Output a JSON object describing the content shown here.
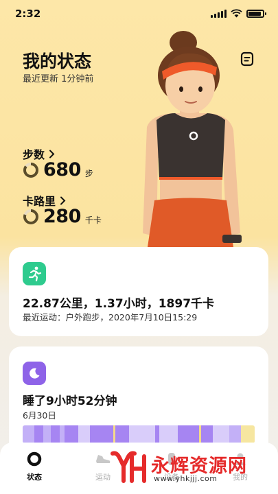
{
  "status_bar": {
    "time": "2:32",
    "battery_level": 0.9
  },
  "header": {
    "title": "我的状态",
    "subtitle": "最近更新 1分钟前",
    "doc_icon": "document-icon"
  },
  "stats": {
    "steps": {
      "label": "步数",
      "value": "680",
      "unit": "步",
      "ring_progress": 0.85
    },
    "calories": {
      "label": "卡路里",
      "value": "280",
      "unit": "千卡",
      "ring_progress": 0.8
    }
  },
  "run_card": {
    "icon": "running-icon",
    "headline": "22.87公里，1.37小时，1897千卡",
    "detail": "最近运动：户外跑步，2020年7月10日15:29",
    "accent": "#2ecb8e"
  },
  "sleep_card": {
    "icon": "moon-icon",
    "headline": "睡了9小时52分钟",
    "date": "6月30日",
    "accent": "#8e63e8",
    "segments": [
      {
        "w": 5,
        "c": "#c3b0f7"
      },
      {
        "w": 4,
        "c": "#a685f2"
      },
      {
        "w": 3,
        "c": "#c3b0f7"
      },
      {
        "w": 4,
        "c": "#a685f2"
      },
      {
        "w": 2,
        "c": "#c3b0f7"
      },
      {
        "w": 6,
        "c": "#a685f2"
      },
      {
        "w": 5,
        "c": "#d9cdfa"
      },
      {
        "w": 10,
        "c": "#a685f2"
      },
      {
        "w": 1,
        "c": "#f3d98a"
      },
      {
        "w": 6,
        "c": "#a685f2"
      },
      {
        "w": 11,
        "c": "#d9cdfa"
      },
      {
        "w": 2,
        "c": "#a685f2"
      },
      {
        "w": 8,
        "c": "#d9cdfa"
      },
      {
        "w": 9,
        "c": "#a685f2"
      },
      {
        "w": 1,
        "c": "#f3d98a"
      },
      {
        "w": 5,
        "c": "#a685f2"
      },
      {
        "w": 7,
        "c": "#d9cdfa"
      },
      {
        "w": 5,
        "c": "#c3b0f7"
      },
      {
        "w": 6,
        "c": "#f6e6a0"
      }
    ]
  },
  "bottom_nav": {
    "items": [
      {
        "label": "状态",
        "icon": "ring-icon",
        "active": true
      },
      {
        "label": "运动",
        "icon": "shoe-icon",
        "active": false
      },
      {
        "label": "设备",
        "icon": "device-icon",
        "active": false
      },
      {
        "label": "我的",
        "icon": "profile-icon",
        "active": false
      }
    ]
  },
  "watermark": {
    "logo_text": "YH",
    "text": "永辉资源网",
    "url": "www.yhkjjj.com"
  }
}
